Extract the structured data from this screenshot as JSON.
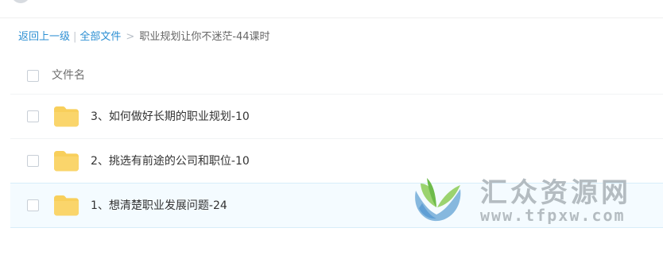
{
  "breadcrumb": {
    "back_label": "返回上一级",
    "separator": "|",
    "all_files_label": "全部文件",
    "arrow": ">",
    "current_folder": "职业规划让你不迷茫-44课时"
  },
  "file_list": {
    "header_label": "文件名",
    "rows": [
      {
        "name": "3、如何做好长期的职业规划-10",
        "icon": "folder-icon",
        "selected": false
      },
      {
        "name": "2、挑选有前途的公司和职位-10",
        "icon": "folder-icon",
        "selected": false
      },
      {
        "name": "1、想清楚职业发展问题-24",
        "icon": "folder-icon",
        "selected": true
      }
    ]
  },
  "watermark": {
    "title": "汇众资源网",
    "url": "www.tfpxw.com"
  },
  "colors": {
    "link": "#2c8fd3",
    "folder": "#f8cf5b",
    "selected_row": "#f4fbff",
    "watermark": "#b4bcc1"
  }
}
